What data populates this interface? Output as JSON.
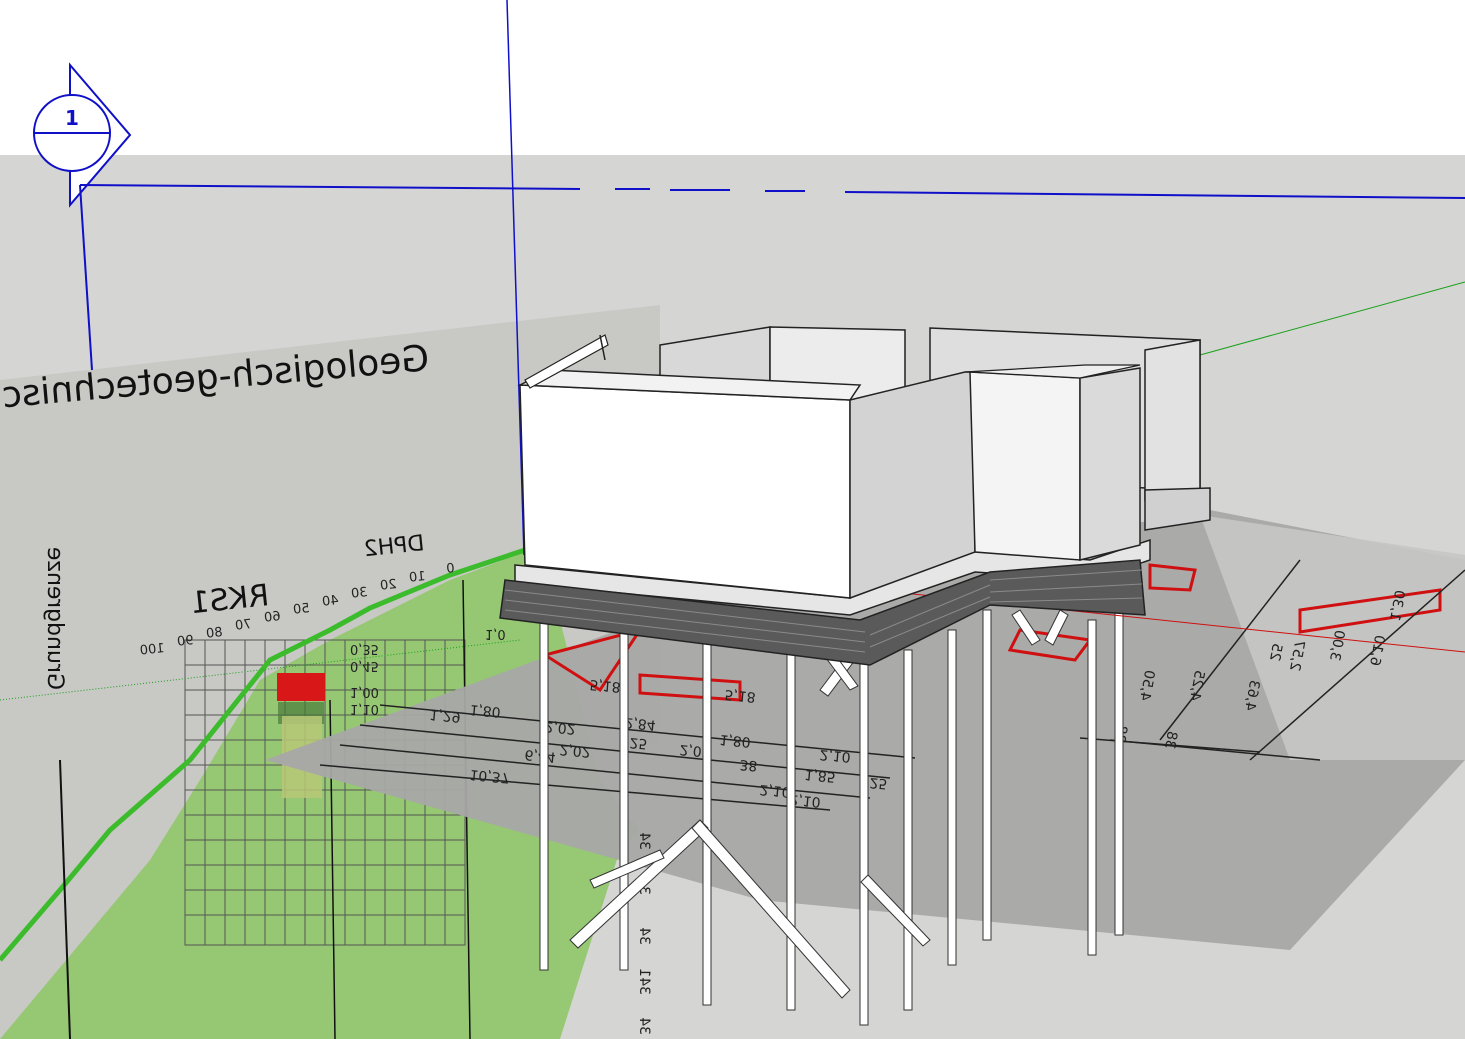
{
  "scene": {
    "section_marker": {
      "number": "1"
    },
    "profile_sheet": {
      "title": "Geologisch-geotechnisc",
      "boreholes": {
        "rks": "RKS1",
        "dph": "DPH2"
      },
      "depth_scale": [
        "0",
        "10",
        "20",
        "30",
        "40",
        "50",
        "60",
        "70",
        "80",
        "90",
        "100"
      ],
      "layer_values": [
        "0,35",
        "0,45",
        "1,00",
        "1,10",
        "1,0"
      ],
      "side_label": "Grundgrenze"
    },
    "plan_dimensions": {
      "row1": [
        "1,80",
        "1,29",
        "2,02",
        "2,84",
        "1,80",
        "2,10"
      ],
      "row2": [
        "2,02",
        "2,02",
        "25",
        "38",
        "1,85",
        "25"
      ],
      "row3": [
        "6,44",
        "2,10"
      ],
      "row4": [
        "10,37",
        "2,10"
      ],
      "right_vertical": [
        "4,50",
        "4,25",
        "4,63",
        "38",
        "38"
      ],
      "right_top": [
        "3,00",
        "2,57",
        "25",
        "6,10",
        "1,30"
      ],
      "plan_small": [
        "5,18",
        "5,18"
      ],
      "vertical_levels": [
        "34",
        "34",
        "34",
        "341",
        "34"
      ]
    },
    "colors": {
      "blue_axis": "#1010c8",
      "red_axis": "#d01010",
      "green_axis": "#18a018",
      "terrain_green": "#90c86a",
      "profile_line_green": "#3cbc2c",
      "warning_red": "#d81818"
    }
  }
}
